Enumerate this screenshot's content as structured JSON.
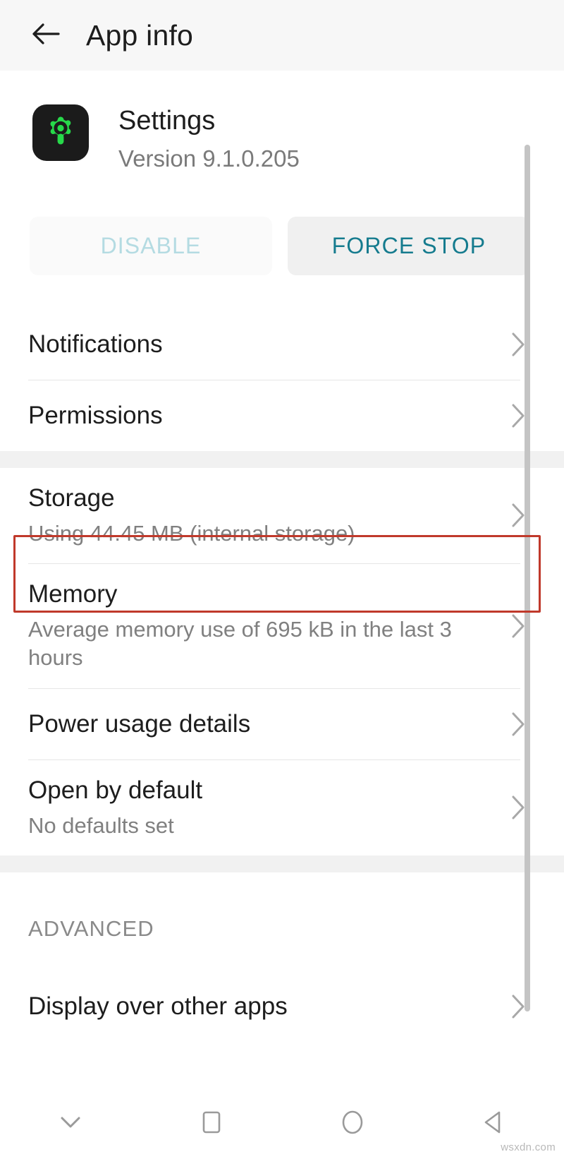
{
  "appbar": {
    "back_icon": "arrow-left-icon",
    "title": "App info"
  },
  "app_header": {
    "icon": "settings-gear-icon",
    "icon_bg": "#1b1b1b",
    "icon_fg": "#27d94a",
    "name": "Settings",
    "version": "Version 9.1.0.205"
  },
  "actions": {
    "disable_label": "DISABLE",
    "disable_enabled": false,
    "force_stop_label": "FORCE STOP",
    "accent_color": "#157b8e",
    "disabled_color": "#b4dbe2"
  },
  "sections": [
    {
      "label": null,
      "rows": [
        {
          "title": "Notifications",
          "sub": null,
          "chevron": "chevron-right-icon",
          "highlighted": false
        },
        {
          "title": "Permissions",
          "sub": null,
          "chevron": "chevron-right-icon",
          "highlighted": false
        }
      ]
    },
    {
      "label": null,
      "rows": [
        {
          "title": "Storage",
          "sub": "Using 44.45 MB (internal storage)",
          "chevron": "chevron-right-icon",
          "highlighted": true
        },
        {
          "title": "Memory",
          "sub": "Average memory use of 695 kB in the last 3 hours",
          "chevron": "chevron-right-icon",
          "highlighted": false
        },
        {
          "title": "Power usage details",
          "sub": null,
          "chevron": "chevron-right-icon",
          "highlighted": false
        },
        {
          "title": "Open by default",
          "sub": "No defaults set",
          "chevron": "chevron-right-icon",
          "highlighted": false
        }
      ]
    },
    {
      "label": "ADVANCED",
      "rows": [
        {
          "title": "Display over other apps",
          "sub": null,
          "chevron": "chevron-right-icon",
          "highlighted": false
        }
      ]
    }
  ],
  "highlight": {
    "color": "#c0392b",
    "target": "Storage"
  },
  "navbar": {
    "items": [
      {
        "icon": "chevron-down-icon",
        "name": "hide-keyboard-button"
      },
      {
        "icon": "square-icon",
        "name": "recents-button"
      },
      {
        "icon": "circle-icon",
        "name": "home-button"
      },
      {
        "icon": "triangle-left-icon",
        "name": "back-button"
      }
    ]
  },
  "watermark": "wsxdn.com"
}
